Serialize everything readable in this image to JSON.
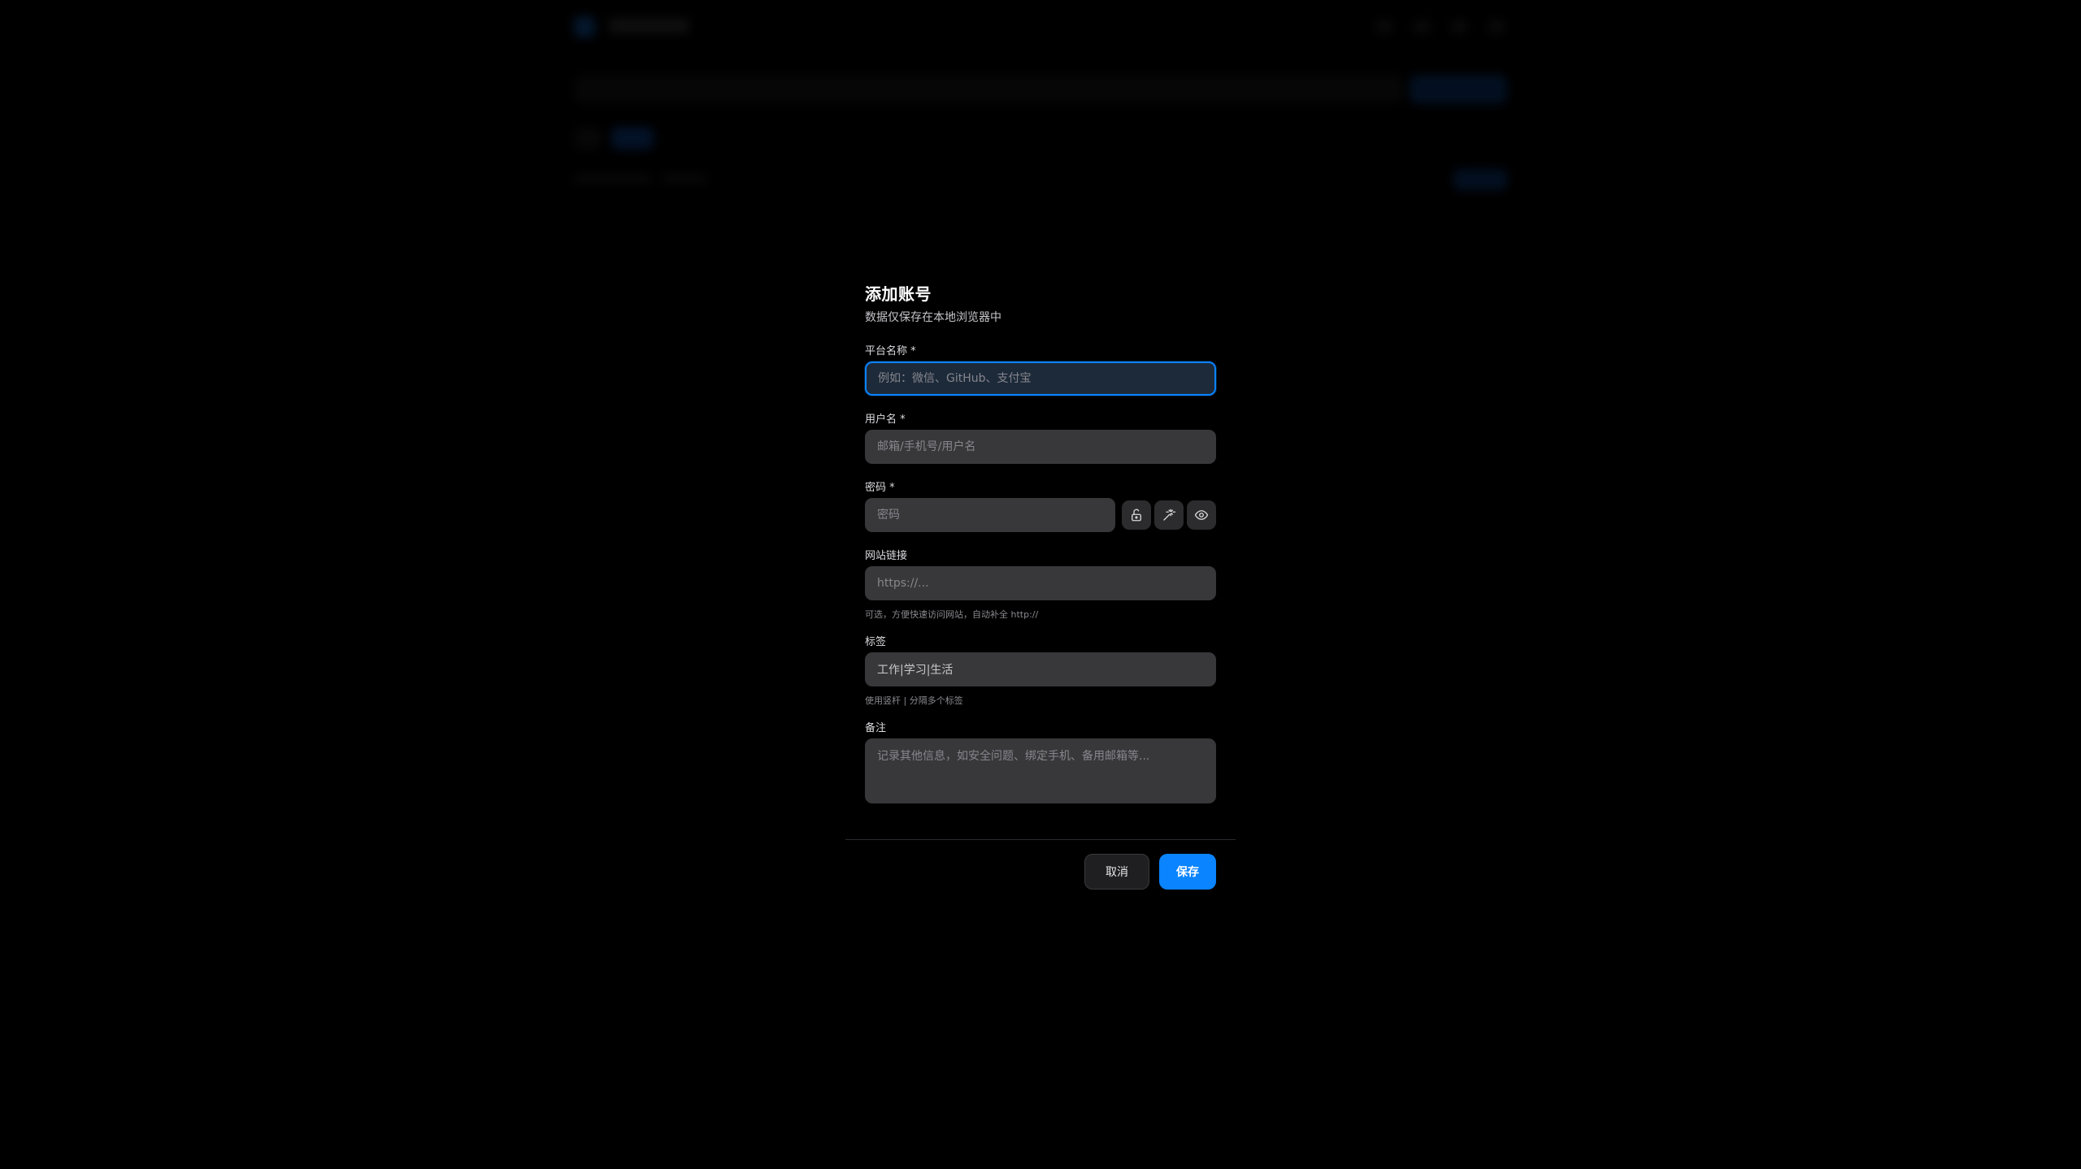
{
  "modal": {
    "title": "添加账号",
    "subtitle": "数据仅保存在本地浏览器中",
    "fields": {
      "platform": {
        "label": "平台名称",
        "required_mark": "*",
        "placeholder": "例如：微信、GitHub、支付宝"
      },
      "username": {
        "label": "用户名",
        "required_mark": "*",
        "placeholder": "邮箱/手机号/用户名"
      },
      "password": {
        "label": "密码",
        "required_mark": "*",
        "placeholder": "密码"
      },
      "website": {
        "label": "网站链接",
        "placeholder": "https://...",
        "hint": "可选，方便快速访问网站，自动补全 http://"
      },
      "tags": {
        "label": "标签",
        "value": "工作|学习|生活",
        "hint": "使用竖杆 | 分隔多个标签"
      },
      "notes": {
        "label": "备注",
        "placeholder": "记录其他信息，如安全问题、绑定手机、备用邮箱等..."
      }
    },
    "password_tools": [
      "lock-open-icon",
      "sparkle-generate-icon",
      "eye-icon"
    ],
    "buttons": {
      "cancel": "取消",
      "save": "保存"
    }
  },
  "colors": {
    "accent": "#0a84ff",
    "background": "#000000",
    "input_bg": "#38383b"
  }
}
